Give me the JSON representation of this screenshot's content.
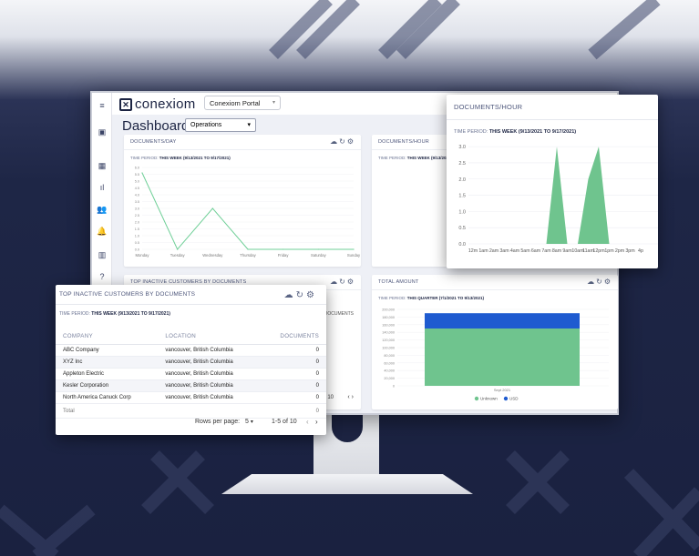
{
  "brand": {
    "name": "conexiom",
    "portal_select": "Conexiom Portal"
  },
  "dashboard": {
    "title": "Dashboard",
    "view_select": "Operations"
  },
  "sidebar": {
    "icons": [
      "menu-icon",
      "contact-card-icon",
      "dashboard-icon",
      "bar-chart-icon",
      "people-icon",
      "bell-icon",
      "building-icon",
      "help-icon"
    ]
  },
  "cards": {
    "docs_day": {
      "title": "DOCUMENTS/DAY",
      "period_label": "TIME PERIOD:",
      "period_value": "THIS WEEK (9/13/2021 TO 9/17/2021)"
    },
    "docs_hour_bg": {
      "title": "DOCUMENTS/HOUR",
      "period_label": "TIME PERIOD:",
      "period_value": "THIS WEEK (9/13/2021 TO 9/17/2021)"
    },
    "inactive_bg": {
      "title": "TOP INACTIVE CUSTOMERS BY DOCUMENTS",
      "col": "DOCUMENTS",
      "page_text": "10"
    },
    "total_amount": {
      "title": "TOTAL AMOUNT",
      "period_label": "TIME PERIOD:",
      "period_value": "THIS QUARTER (7/1/2021 TO 9/13/2021)"
    }
  },
  "popup_hours": {
    "title": "DOCUMENTS/HOUR",
    "period_label": "TIME PERIOD:",
    "period_value": "THIS WEEK (9/13/2021 TO 9/17/2021)"
  },
  "popup_customers": {
    "title": "TOP INACTIVE CUSTOMERS BY DOCUMENTS",
    "period_label": "TIME PERIOD:",
    "period_value": "THIS WEEK (9/13/2021 TO 9/17/2021)",
    "columns": [
      "COMPANY",
      "LOCATION",
      "DOCUMENTS"
    ],
    "rows": [
      {
        "company": "ABC Company",
        "location": "vancouver, British Columbia",
        "documents": "0"
      },
      {
        "company": "XYZ Inc",
        "location": "vancouver, British Columbia",
        "documents": "0"
      },
      {
        "company": "Appleton Electric",
        "location": "vancouver, British Columbia",
        "documents": "0"
      },
      {
        "company": "Kesler Corporation",
        "location": "vancouver, British Columbia",
        "documents": "0"
      },
      {
        "company": "North America Canuck Corp",
        "location": "vancouver, British Columbia",
        "documents": "0"
      }
    ],
    "total_label": "Total",
    "total_value": "0",
    "rows_per_page_label": "Rows per page:",
    "rows_per_page_value": "5",
    "range_text": "1-5 of 10"
  },
  "chart_data": [
    {
      "type": "line",
      "title": "DOCUMENTS/DAY",
      "categories": [
        "Monday",
        "Tuesday",
        "Wednesday",
        "Thursday",
        "Friday",
        "Saturday",
        "Sunday"
      ],
      "y_ticks": [
        "0.0",
        "0.5",
        "1.0",
        "1.5",
        "2.0",
        "2.5",
        "3.0",
        "3.5",
        "4.0",
        "4.5",
        "5.0",
        "5.5",
        "6.0"
      ],
      "values": [
        5.6,
        0,
        3,
        0,
        0,
        0,
        0
      ],
      "ylim": [
        0,
        6
      ],
      "color": "#6fcf97"
    },
    {
      "type": "area",
      "title": "DOCUMENTS/HOUR",
      "categories": [
        "12m",
        "1am",
        "2am",
        "3am",
        "4am",
        "5am",
        "6am",
        "7am",
        "8am",
        "9am",
        "10am",
        "11am",
        "12pm",
        "1pm",
        "2pm",
        "3pm",
        "4p"
      ],
      "y_ticks": [
        "0.0",
        "0.5",
        "1.0",
        "1.5",
        "2.0",
        "2.5",
        "3.0"
      ],
      "values": [
        0,
        0,
        0,
        0,
        0,
        0,
        0,
        0,
        3,
        0,
        0,
        2,
        3,
        0,
        0,
        0,
        0
      ],
      "ylim": [
        0,
        3.2
      ],
      "color": "#6fc48e"
    },
    {
      "type": "bar",
      "title": "TOTAL AMOUNT",
      "categories": [
        "Sept 2021"
      ],
      "series": [
        {
          "name": "Unknown",
          "values": [
            150000
          ],
          "color": "#6fc48e"
        },
        {
          "name": "USD",
          "values": [
            40000
          ],
          "color": "#1f5bd0"
        }
      ],
      "y_ticks": [
        "0",
        "20,000",
        "40,000",
        "60,000",
        "80,000",
        "100,000",
        "120,000",
        "140,000",
        "160,000",
        "180,000",
        "200,000"
      ],
      "ylim": [
        0,
        200000
      ]
    }
  ]
}
